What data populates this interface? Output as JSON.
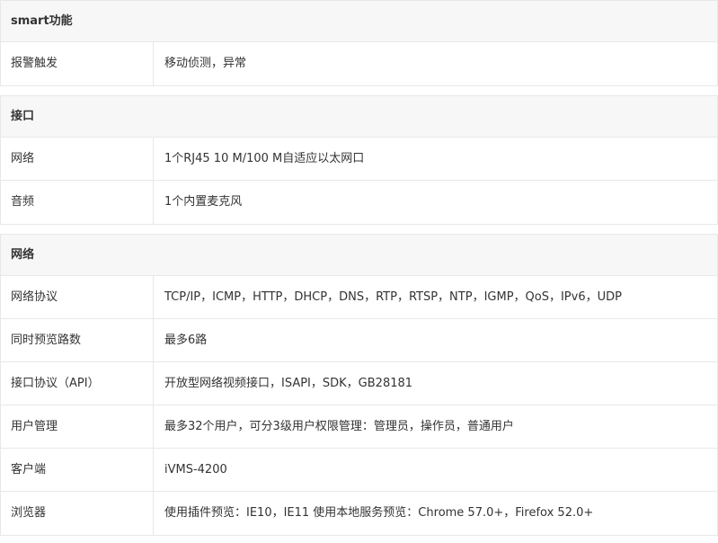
{
  "sections": [
    {
      "title": "smart功能",
      "rows": [
        {
          "label": "报警触发",
          "value": "移动侦测，异常"
        }
      ]
    },
    {
      "title": "接口",
      "rows": [
        {
          "label": "网络",
          "value": "1个RJ45 10 M/100 M自适应以太网口"
        },
        {
          "label": "音频",
          "value": "1个内置麦克风"
        }
      ]
    },
    {
      "title": "网络",
      "rows": [
        {
          "label": "网络协议",
          "value": "TCP/IP，ICMP，HTTP，DHCP，DNS，RTP，RTSP，NTP，IGMP，QoS，IPv6，UDP"
        },
        {
          "label": "同时预览路数",
          "value": "最多6路"
        },
        {
          "label": "接口协议（API）",
          "value": "开放型网络视频接口，ISAPI，SDK，GB28181"
        },
        {
          "label": "用户管理",
          "value": "最多32个用户，可分3级用户权限管理：管理员，操作员，普通用户"
        },
        {
          "label": "客户端",
          "value": "iVMS-4200"
        },
        {
          "label": "浏览器",
          "value": "使用插件预览：IE10，IE11 使用本地服务预览：Chrome 57.0+，Firefox 52.0+"
        }
      ]
    }
  ]
}
